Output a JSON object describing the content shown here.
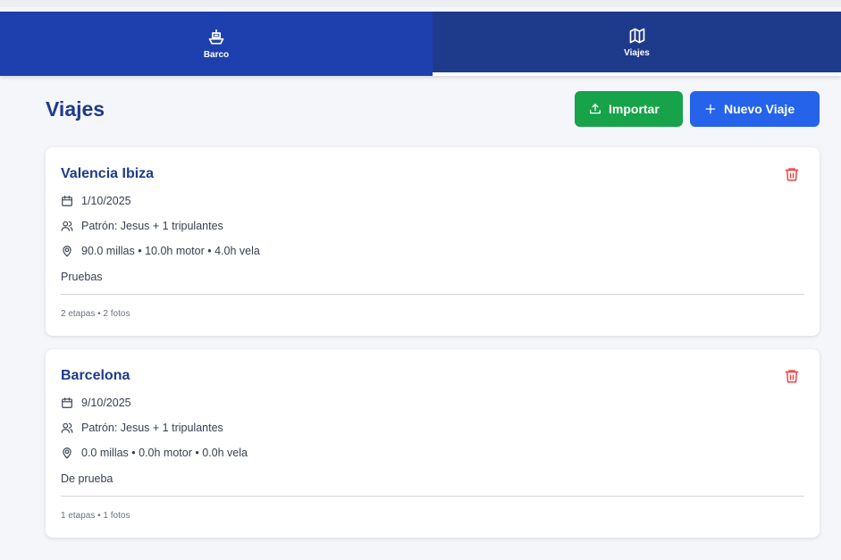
{
  "tabs": [
    {
      "label": "Barco",
      "icon": "sailboat-icon"
    },
    {
      "label": "Viajes",
      "icon": "map-icon"
    }
  ],
  "colors": {
    "tab_inactive": "#1e40af",
    "tab_active": "#1e3a8a",
    "title": "#1e3a8a",
    "import_button": "#16a34a",
    "new_button": "#2563eb",
    "delete_icon": "#ef4444"
  },
  "header": {
    "title": "Viajes",
    "import_label": "Importar",
    "new_label": "Nuevo Viaje"
  },
  "trips": [
    {
      "name": "Valencia Ibiza",
      "date": "1/10/2025",
      "crew": "Patrón: Jesus + 1 tripulantes",
      "stats": "90.0 millas • 10.0h motor • 4.0h vela",
      "notes": "Pruebas",
      "footer": "2 etapas • 2 fotos"
    },
    {
      "name": "Barcelona",
      "date": "9/10/2025",
      "crew": "Patrón: Jesus + 1 tripulantes",
      "stats": "0.0 millas • 0.0h motor • 0.0h vela",
      "notes": "De prueba",
      "footer": "1 etapas • 1 fotos"
    }
  ]
}
